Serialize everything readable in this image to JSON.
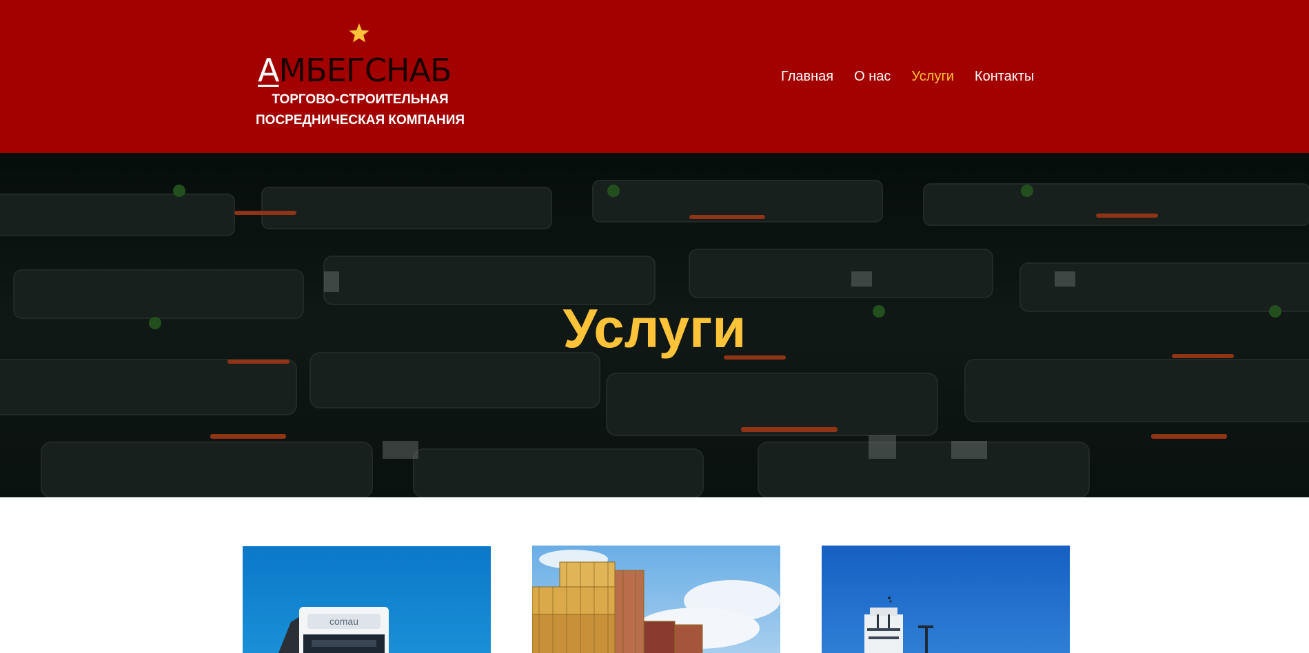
{
  "header": {
    "logo": {
      "initial": "А",
      "rest": "МБЕГСНАБ",
      "subtitle_line1": "ТОРГОВО-СТРОИТЕЛЬНАЯ",
      "subtitle_line2": "ПОСРЕДНИЧЕСКАЯ КОМПАНИЯ",
      "icon": "star-icon"
    },
    "nav": [
      {
        "label": "Главная",
        "active": false
      },
      {
        "label": "О нас",
        "active": false
      },
      {
        "label": "Услуги",
        "active": true
      },
      {
        "label": "Контакты",
        "active": false
      }
    ]
  },
  "hero": {
    "title": "Услуги"
  },
  "services": {
    "cards": [
      {
        "image": "truck-image"
      },
      {
        "image": "containers-image"
      },
      {
        "image": "ship-image"
      }
    ]
  },
  "colors": {
    "header_bg": "#a30000",
    "accent": "#ffc33a",
    "hero_bg": "#0b1613"
  }
}
